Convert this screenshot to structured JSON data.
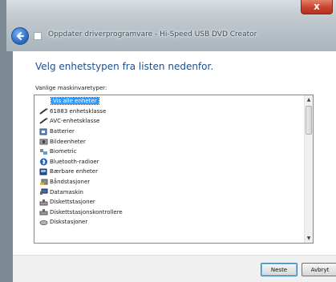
{
  "window": {
    "title": "Oppdater driverprogramvare - Hi-Speed USB DVD Creator",
    "close_symbol": "x"
  },
  "main": {
    "heading": "Velg enhetstypen fra listen nedenfor.",
    "list_label": "Vanlige maskinvaretyper:",
    "items": [
      {
        "label": "Vis alle enheter",
        "icon": "blank-icon",
        "selected": true
      },
      {
        "label": "61883 enhetsklasse",
        "icon": "cable-icon"
      },
      {
        "label": "AVC-enhetsklasse",
        "icon": "cable-icon"
      },
      {
        "label": "Batterier",
        "icon": "battery-icon"
      },
      {
        "label": "Bildeenheter",
        "icon": "camera-icon"
      },
      {
        "label": "Biometric",
        "icon": "fingerprint-icon"
      },
      {
        "label": "Bluetooth-radioer",
        "icon": "bluetooth-icon"
      },
      {
        "label": "Bærbare enheter",
        "icon": "portable-device-icon"
      },
      {
        "label": "Båndstasjoner",
        "icon": "tape-drive-icon"
      },
      {
        "label": "Datamaskin",
        "icon": "computer-icon"
      },
      {
        "label": "Diskettstasjoner",
        "icon": "floppy-drive-icon"
      },
      {
        "label": "Diskettstasjonskontrollere",
        "icon": "floppy-controller-icon"
      },
      {
        "label": "Diskstasjoner",
        "icon": "disk-drive-icon"
      }
    ]
  },
  "footer": {
    "next_label": "Neste",
    "cancel_label": "Avbryt"
  }
}
